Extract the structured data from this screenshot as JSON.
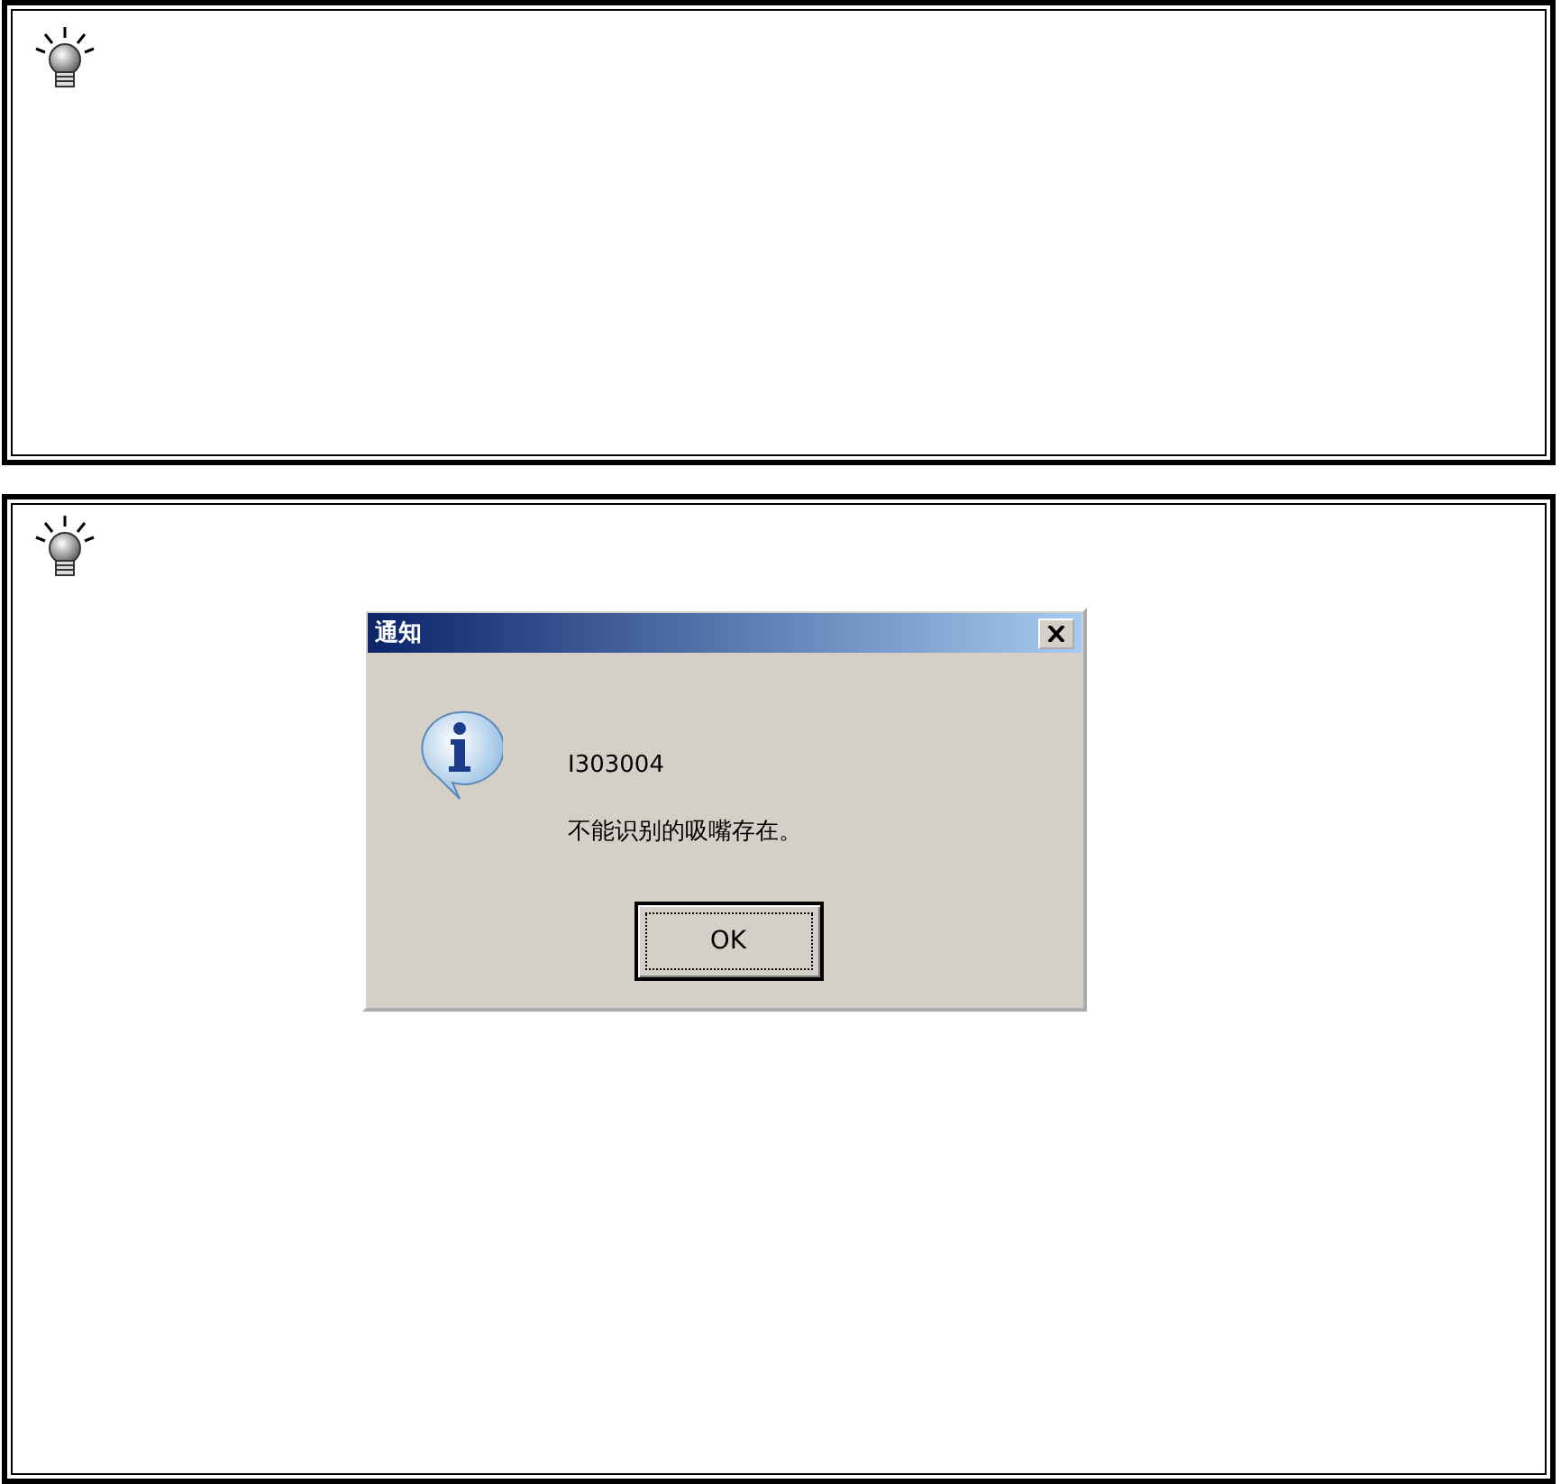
{
  "panels": [
    {
      "kind": "tip"
    },
    {
      "kind": "tip",
      "dialog": {
        "title": "通知",
        "code": "I303004",
        "message": "不能识别的吸嘴存在。",
        "button": "OK"
      }
    }
  ]
}
